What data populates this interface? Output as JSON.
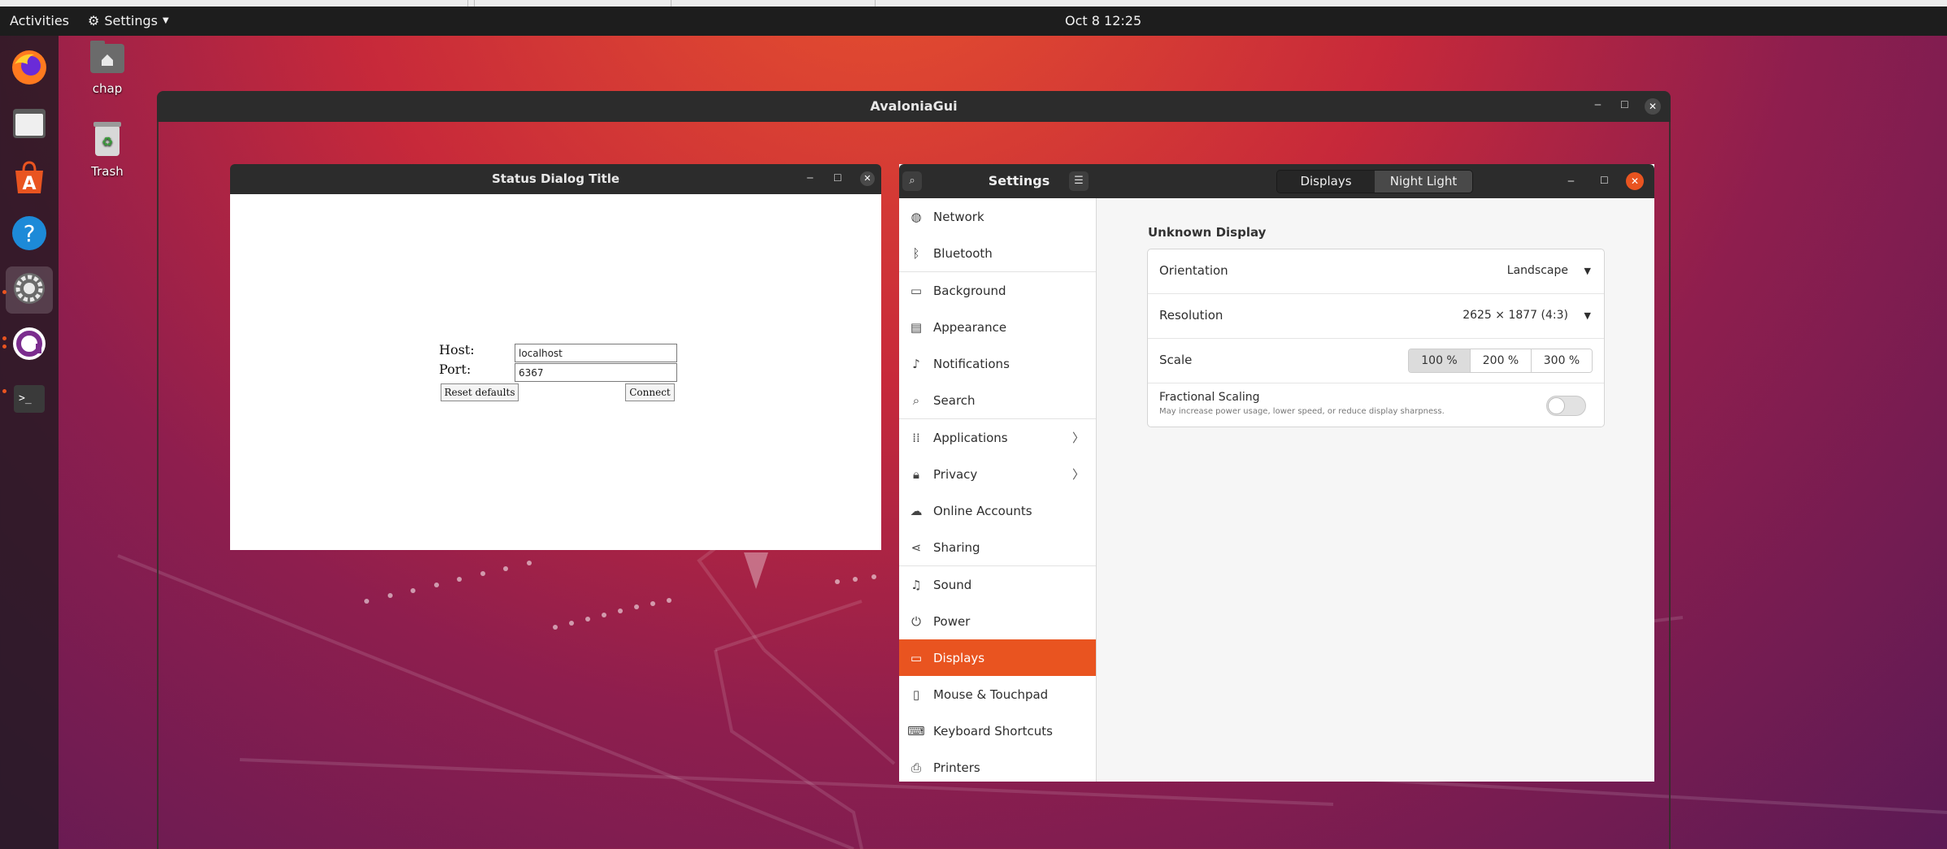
{
  "topbar": {
    "activities": "Activities",
    "app_menu": "Settings",
    "clock": "Oct 8  12:25"
  },
  "desktop": {
    "icons": [
      {
        "label": "chap",
        "icon": "home-folder-icon"
      },
      {
        "label": "Trash",
        "icon": "trash-icon"
      }
    ]
  },
  "dock": {
    "items": [
      {
        "name": "firefox",
        "icon": "firefox-icon"
      },
      {
        "name": "files",
        "icon": "files-icon"
      },
      {
        "name": "software",
        "icon": "software-store-icon"
      },
      {
        "name": "help",
        "icon": "help-icon"
      },
      {
        "name": "settings",
        "icon": "settings-icon"
      },
      {
        "name": "avalonia",
        "icon": "avalonia-app-icon"
      },
      {
        "name": "terminal",
        "icon": "terminal-icon"
      }
    ]
  },
  "ava_window": {
    "title": "AvaloniaGui"
  },
  "status_dialog": {
    "title": "Status Dialog Title",
    "host_label": "Host:",
    "host_value": "localhost",
    "port_label": "Port:",
    "port_value": "6367",
    "reset_label": "Reset defaults",
    "connect_label": "Connect"
  },
  "settings": {
    "title": "Settings",
    "tabs": [
      {
        "label": "Displays",
        "active": true
      },
      {
        "label": "Night Light",
        "active": false
      }
    ],
    "sidebar": [
      {
        "label": "Network",
        "icon": "network-icon",
        "arrow": false
      },
      {
        "label": "Bluetooth",
        "icon": "bluetooth-icon",
        "arrow": false
      },
      {
        "label": "Background",
        "icon": "background-icon",
        "arrow": false
      },
      {
        "label": "Appearance",
        "icon": "appearance-icon",
        "arrow": false
      },
      {
        "label": "Notifications",
        "icon": "notifications-icon",
        "arrow": false
      },
      {
        "label": "Search",
        "icon": "search-icon",
        "arrow": false
      },
      {
        "label": "Applications",
        "icon": "applications-icon",
        "arrow": true
      },
      {
        "label": "Privacy",
        "icon": "privacy-icon",
        "arrow": true
      },
      {
        "label": "Online Accounts",
        "icon": "online-accounts-icon",
        "arrow": false
      },
      {
        "label": "Sharing",
        "icon": "sharing-icon",
        "arrow": false
      },
      {
        "label": "Sound",
        "icon": "sound-icon",
        "arrow": false
      },
      {
        "label": "Power",
        "icon": "power-icon",
        "arrow": false
      },
      {
        "label": "Displays",
        "icon": "displays-icon",
        "arrow": false,
        "selected": true
      },
      {
        "label": "Mouse & Touchpad",
        "icon": "mouse-icon",
        "arrow": false
      },
      {
        "label": "Keyboard Shortcuts",
        "icon": "keyboard-icon",
        "arrow": false
      },
      {
        "label": "Printers",
        "icon": "printer-icon",
        "arrow": false
      }
    ],
    "display": {
      "section_title": "Unknown Display",
      "orientation_label": "Orientation",
      "orientation_value": "Landscape",
      "resolution_label": "Resolution",
      "resolution_value": "2625 × 1877 (4:3)",
      "scale_label": "Scale",
      "scale_options": [
        "100 %",
        "200 %",
        "300 %"
      ],
      "scale_selected": "100 %",
      "fractional_label": "Fractional Scaling",
      "fractional_desc": "May increase power usage, lower speed, or reduce display sharpness.",
      "fractional_on": false
    }
  },
  "colors": {
    "accent": "#e95420",
    "titlebar": "#2c2c2c"
  }
}
